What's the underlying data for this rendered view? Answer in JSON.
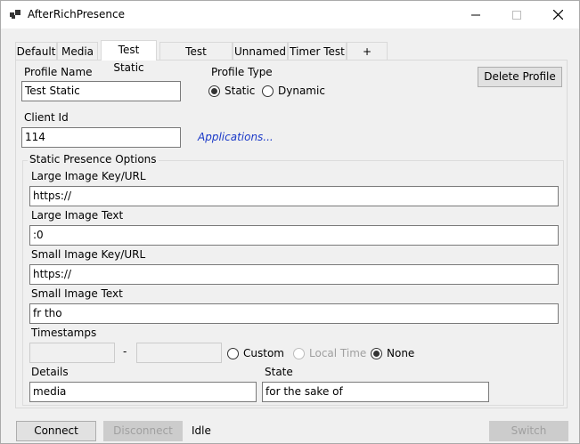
{
  "window": {
    "title": "AfterRichPresence"
  },
  "tabs": [
    {
      "label": "Default"
    },
    {
      "label": "Media"
    },
    {
      "label": "Test Static"
    },
    {
      "label": "Test Dynamic"
    },
    {
      "label": "Unnamed"
    },
    {
      "label": "Timer Test"
    },
    {
      "label": "+"
    }
  ],
  "profile": {
    "name_label": "Profile Name",
    "name_value": "Test Static",
    "type_label": "Profile Type",
    "type_static": "Static",
    "type_dynamic": "Dynamic",
    "delete_label": "Delete Profile",
    "client_id_label": "Client Id",
    "client_id_value": "114",
    "applications_link": "Applications..."
  },
  "static_options": {
    "group_label": "Static Presence Options",
    "large_image_key_label": "Large Image Key/URL",
    "large_image_key_value": "https://",
    "large_image_text_label": "Large Image Text",
    "large_image_text_value": ":0",
    "small_image_key_label": "Small Image Key/URL",
    "small_image_key_value": "https://",
    "small_image_text_label": "Small Image Text",
    "small_image_text_value": "fr tho",
    "timestamps_label": "Timestamps",
    "timestamps_separator": "-",
    "ts_custom": "Custom",
    "ts_local_time": "Local Time",
    "ts_none": "None",
    "details_label": "Details",
    "details_value": "media",
    "state_label": "State",
    "state_value": "for the sake of"
  },
  "footer": {
    "connect_label": "Connect",
    "disconnect_label": "Disconnect",
    "status_text": "Idle",
    "switch_label": "Switch"
  }
}
